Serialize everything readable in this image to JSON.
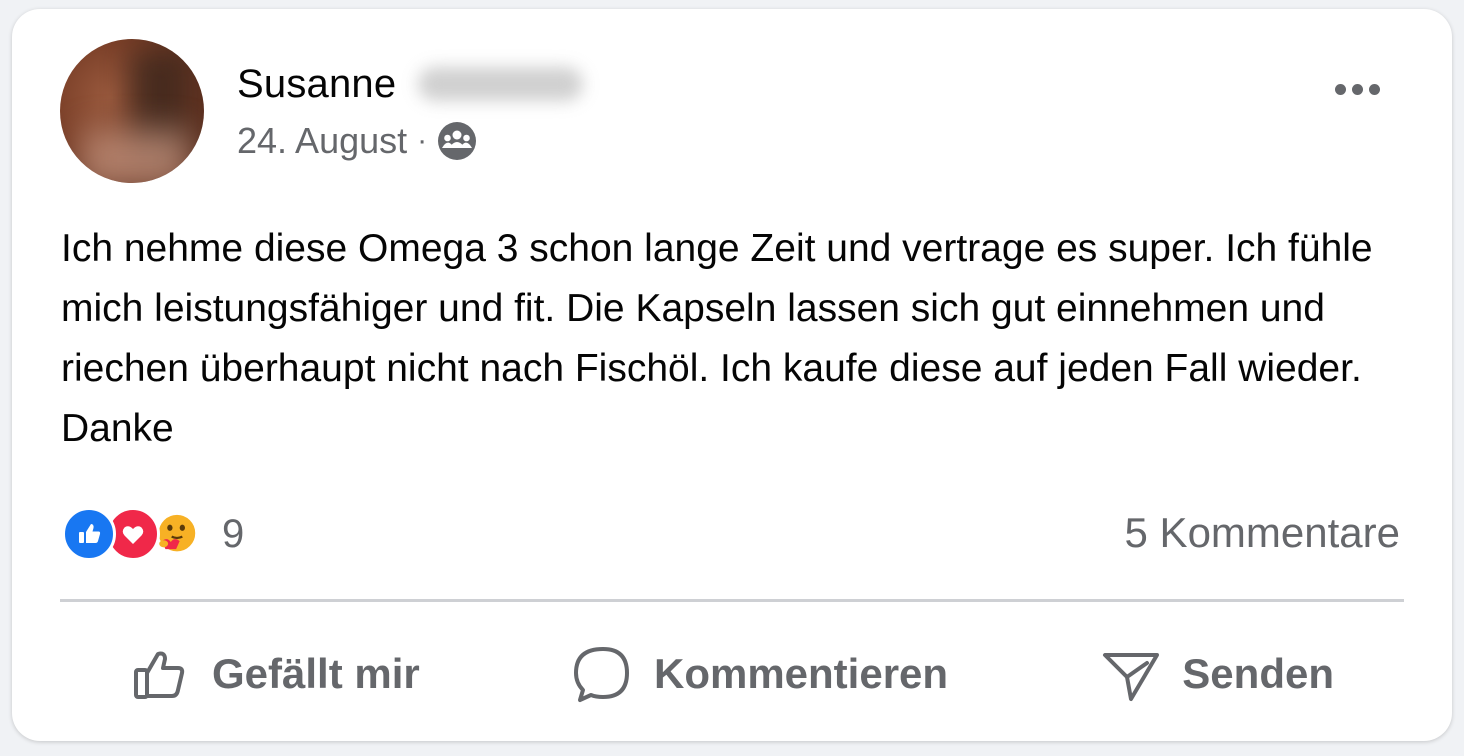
{
  "post": {
    "author_first_name": "Susanne",
    "date": "24. August",
    "meta_separator": "·",
    "audience_icon": "group-icon",
    "text": "Ich nehme diese Omega 3 schon lange Zeit und vertrage es super. Ich fühle mich leistungsfähiger und fit. Die Kapseln lassen sich gut einnehmen und riechen überhaupt nicht nach Fischöl. Ich kaufe diese auf jeden Fall wieder. Danke"
  },
  "reactions": {
    "icons": [
      "like-reaction-icon",
      "love-reaction-icon",
      "care-reaction-icon"
    ],
    "count": "9"
  },
  "comments": {
    "label": "5 Kommentare"
  },
  "actions": {
    "like_label": "Gefällt mir",
    "comment_label": "Kommentieren",
    "share_label": "Senden"
  },
  "colors": {
    "like_blue": "#1877f2",
    "love_red": "#f02849",
    "secondary_text": "#65676b",
    "primary_text": "#050505"
  }
}
